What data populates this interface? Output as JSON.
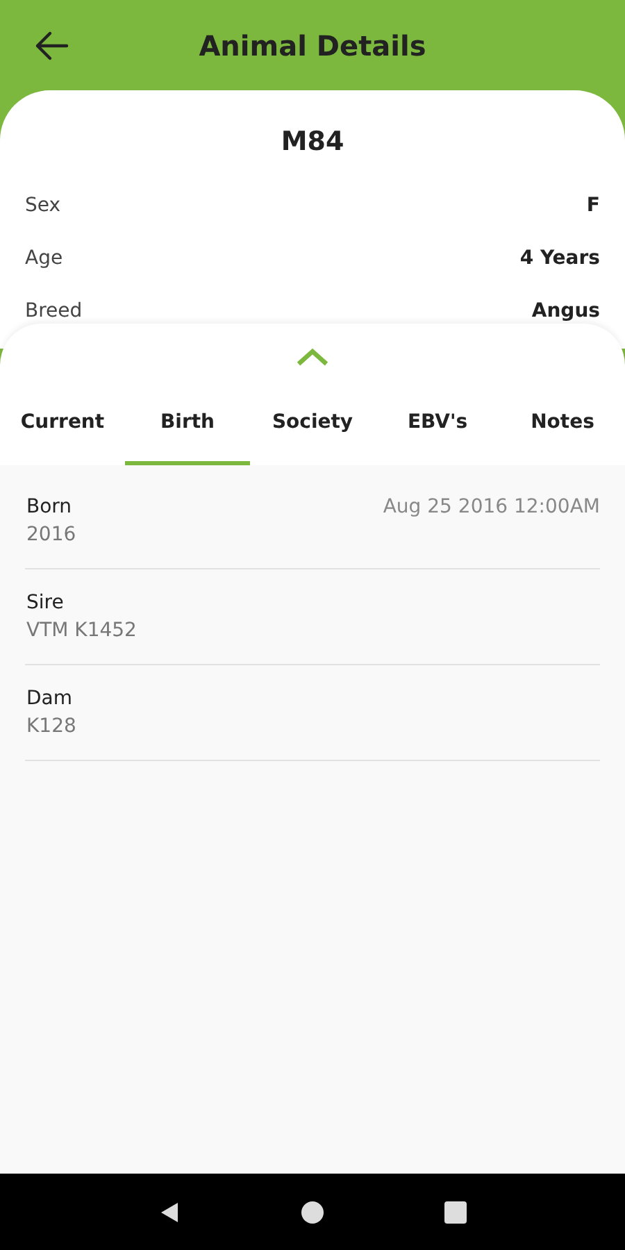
{
  "header": {
    "title": "Animal Details"
  },
  "animal": {
    "tag": "M84",
    "attributes": [
      {
        "label": "Sex",
        "value": "F"
      },
      {
        "label": "Age",
        "value": "4 Years"
      },
      {
        "label": "Breed",
        "value": "Angus"
      }
    ]
  },
  "tabs": [
    {
      "label": "Current",
      "selected": false
    },
    {
      "label": "Birth",
      "selected": true
    },
    {
      "label": "Society",
      "selected": false
    },
    {
      "label": "EBV's",
      "selected": false
    },
    {
      "label": "Notes",
      "selected": false
    }
  ],
  "details": [
    {
      "label": "Born",
      "value": "2016",
      "date": "Aug 25 2016 12:00AM"
    },
    {
      "label": "Sire",
      "value": "VTM K1452"
    },
    {
      "label": "Dam",
      "value": "K128"
    }
  ]
}
